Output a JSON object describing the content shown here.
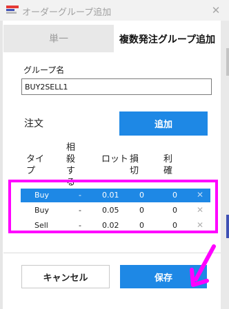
{
  "window": {
    "title": "オーダーグループ追加",
    "close_glyph": "✕",
    "icon": "app-icon"
  },
  "tabs": [
    {
      "label": "単一",
      "active": false
    },
    {
      "label": "複数発注グループ追加",
      "active": true
    }
  ],
  "group": {
    "label": "グループ名",
    "value": "BUY2SELL1"
  },
  "order": {
    "label": "注文",
    "add_label": "追加"
  },
  "table": {
    "columns": [
      "タイプ",
      "相殺する",
      "ロット",
      "損切",
      "利確"
    ],
    "rows": [
      {
        "type": "Buy",
        "offset": "-",
        "lot": "0.01",
        "sl": "0",
        "tp": "0",
        "selected": true
      },
      {
        "type": "Buy",
        "offset": "-",
        "lot": "0.05",
        "sl": "0",
        "tp": "0",
        "selected": false
      },
      {
        "type": "Sell",
        "offset": "-",
        "lot": "0.02",
        "sl": "0",
        "tp": "0",
        "selected": false
      }
    ],
    "delete_glyph": "✕"
  },
  "footer": {
    "cancel_label": "キャンセル",
    "save_label": "保存"
  },
  "annotation": {
    "highlight_color": "#ff00ff",
    "arrow_color": "#ff00ff"
  },
  "colors": {
    "accent": "#1e88e5",
    "title_text": "#a0a0a0"
  }
}
